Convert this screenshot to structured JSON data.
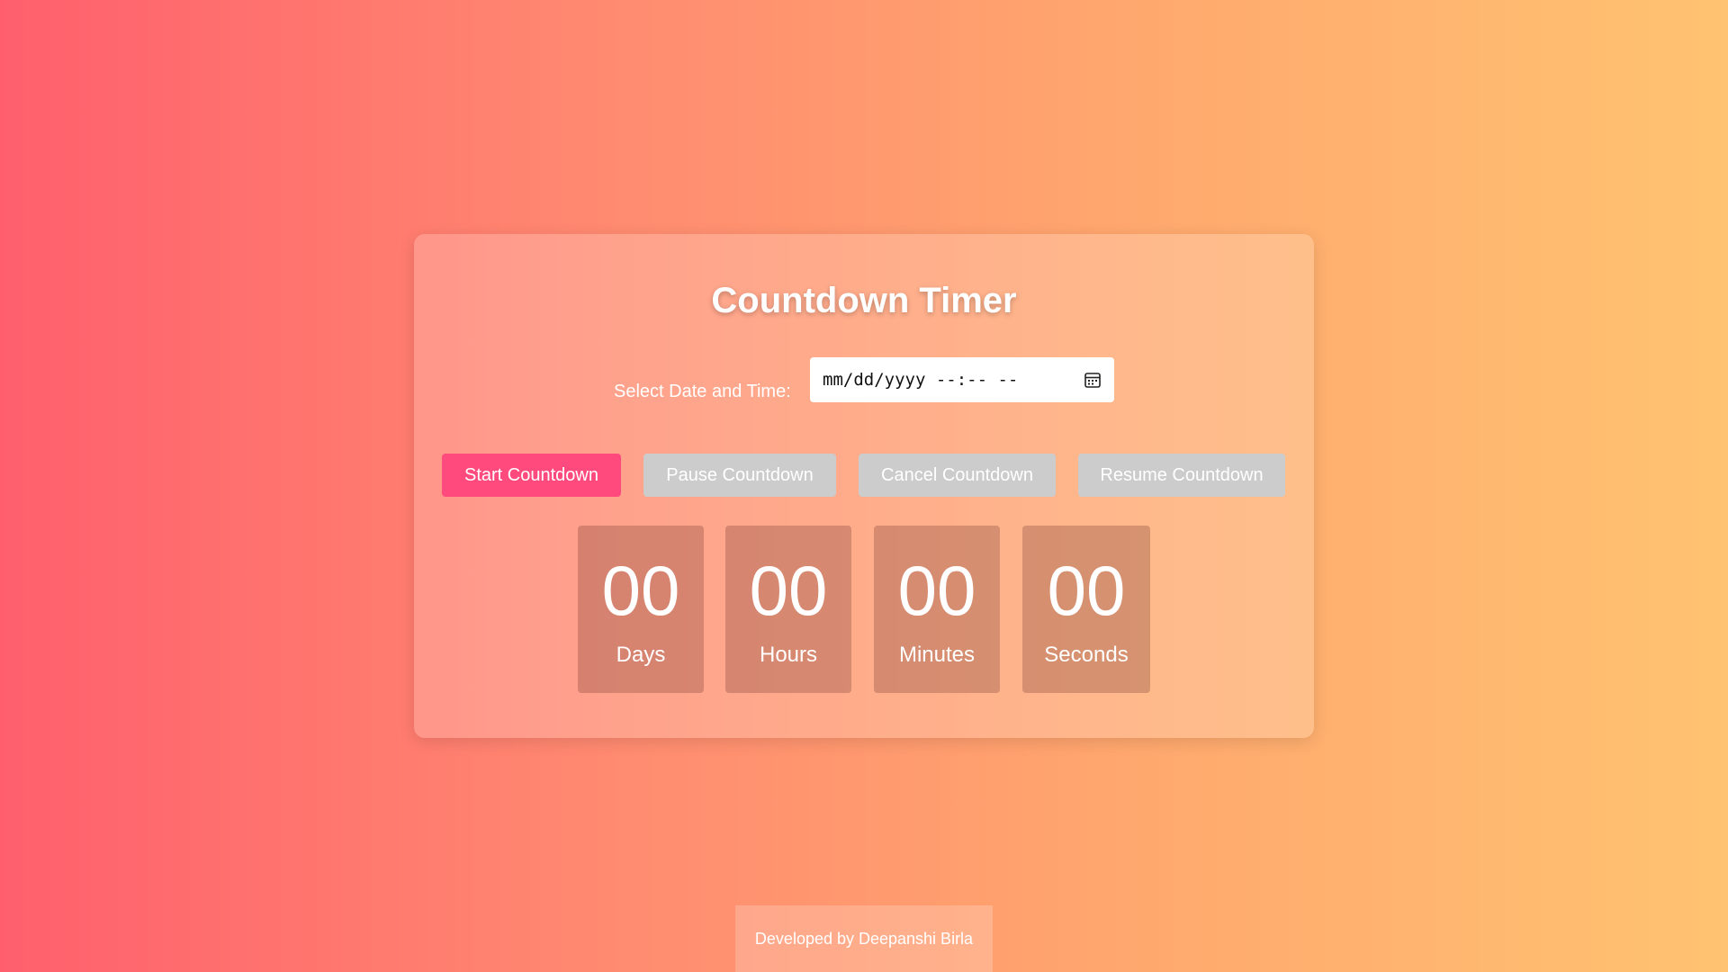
{
  "app": {
    "title": "Countdown Timer"
  },
  "picker": {
    "label": "Select Date and Time:",
    "placeholder": "mm/dd/yyyy --:-- --",
    "icon": "calendar-icon"
  },
  "buttons": {
    "start": "Start Countdown",
    "pause": "Pause Countdown",
    "cancel": "Cancel Countdown",
    "resume": "Resume Countdown"
  },
  "timer": {
    "days": {
      "value": "00",
      "label": "Days"
    },
    "hours": {
      "value": "00",
      "label": "Hours"
    },
    "minutes": {
      "value": "00",
      "label": "Minutes"
    },
    "seconds": {
      "value": "00",
      "label": "Seconds"
    }
  },
  "footer": {
    "text": "Developed by Deepanshi Birla"
  },
  "colors": {
    "gradient_start": "#ff5f6d",
    "gradient_end": "#ffc371",
    "primary_button": "#ff4a7d",
    "disabled_button": "#cccccc"
  }
}
